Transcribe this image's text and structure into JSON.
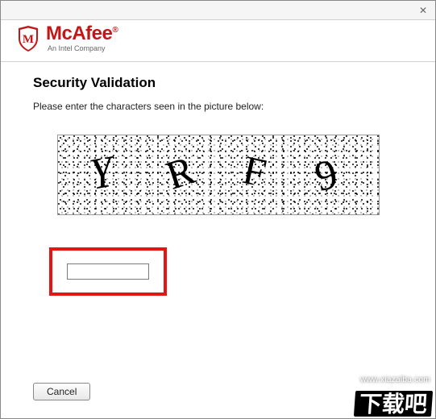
{
  "titlebar": {
    "close_glyph": "✕"
  },
  "brand": {
    "name": "McAfee",
    "tagline": "An Intel Company"
  },
  "content": {
    "heading": "Security Validation",
    "instruction": "Please enter the characters seen in the picture below:"
  },
  "captcha": {
    "chars": [
      "Y",
      "R",
      "F",
      "9"
    ],
    "input_value": ""
  },
  "footer": {
    "cancel_label": "Cancel"
  },
  "watermark": {
    "text": "下载吧",
    "url": "www.xiazaiba.com"
  },
  "colors": {
    "brand_red": "#c01818",
    "highlight_red": "#e51515"
  }
}
